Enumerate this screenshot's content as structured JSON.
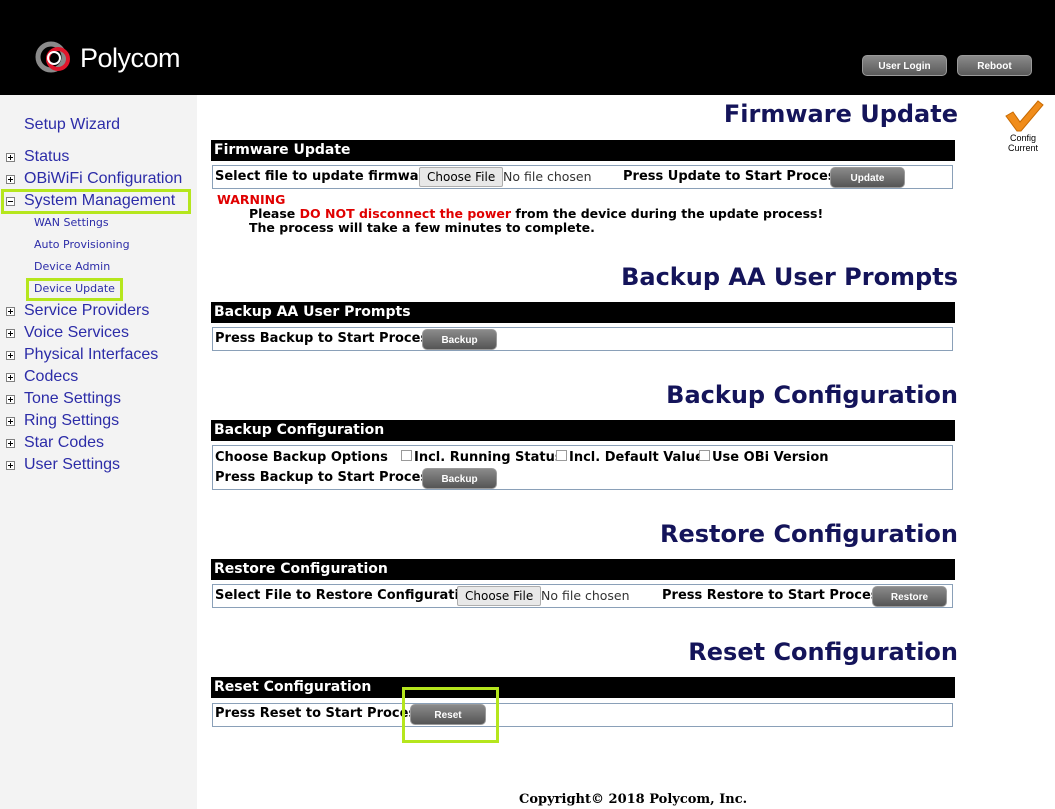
{
  "header": {
    "brand": "Polycom",
    "user_login_label": "User Login",
    "reboot_label": "Reboot"
  },
  "sidebar": {
    "setup_wizard": "Setup Wizard",
    "items": [
      {
        "label": "Status",
        "expanded": false
      },
      {
        "label": "OBiWiFi Configuration",
        "expanded": false
      },
      {
        "label": "System Management",
        "expanded": true
      },
      {
        "label": "Service Providers",
        "expanded": false
      },
      {
        "label": "Voice Services",
        "expanded": false
      },
      {
        "label": "Physical Interfaces",
        "expanded": false
      },
      {
        "label": "Codecs",
        "expanded": false
      },
      {
        "label": "Tone Settings",
        "expanded": false
      },
      {
        "label": "Ring Settings",
        "expanded": false
      },
      {
        "label": "Star Codes",
        "expanded": false
      },
      {
        "label": "User Settings",
        "expanded": false
      }
    ],
    "sub_items": [
      "WAN Settings",
      "Auto Provisioning",
      "Device Admin",
      "Device Update"
    ],
    "selected_sub_item": "Device Update"
  },
  "config_status": {
    "line1": "Config",
    "line2": "Current"
  },
  "firmware": {
    "title": "Firmware Update",
    "bar": "Firmware Update",
    "select_label": "Select file to update firmware",
    "choose_file": "Choose File",
    "no_file": "No file chosen",
    "press_label": "Press Update to Start Process",
    "button": "Update",
    "warning_title": "WARNING",
    "warning_pre": "Please ",
    "warning_red": "DO NOT disconnect the power",
    "warning_post": " from the device during the update process!",
    "warning_line2": "The process will take a few minutes to complete."
  },
  "backup_prompts": {
    "title": "Backup AA User Prompts",
    "bar": "Backup AA User Prompts",
    "press_label": "Press Backup to Start Process",
    "button": "Backup"
  },
  "backup_config": {
    "title": "Backup Configuration",
    "bar": "Backup Configuration",
    "options_label": "Choose Backup Options",
    "opt_running": "Incl. Running Status",
    "opt_default": "Incl. Default Value",
    "opt_obi": "Use OBi Version",
    "press_label": "Press Backup to Start Process",
    "button": "Backup"
  },
  "restore_config": {
    "title": "Restore Configuration",
    "bar": "Restore Configuration",
    "select_label": "Select File to Restore Configuration",
    "choose_file": "Choose File",
    "no_file": "No file chosen",
    "press_label": "Press Restore to Start Process",
    "button": "Restore"
  },
  "reset_config": {
    "title": "Reset Configuration",
    "bar": "Reset Configuration",
    "press_label": "Press Reset to Start Process",
    "button": "Reset"
  },
  "footer": "Copyright© 2018 Polycom, Inc.",
  "colors": {
    "heading": "#14145a",
    "nav_link": "#2c2ca8",
    "highlight": "#b5e61d",
    "warning": "#e00000"
  }
}
